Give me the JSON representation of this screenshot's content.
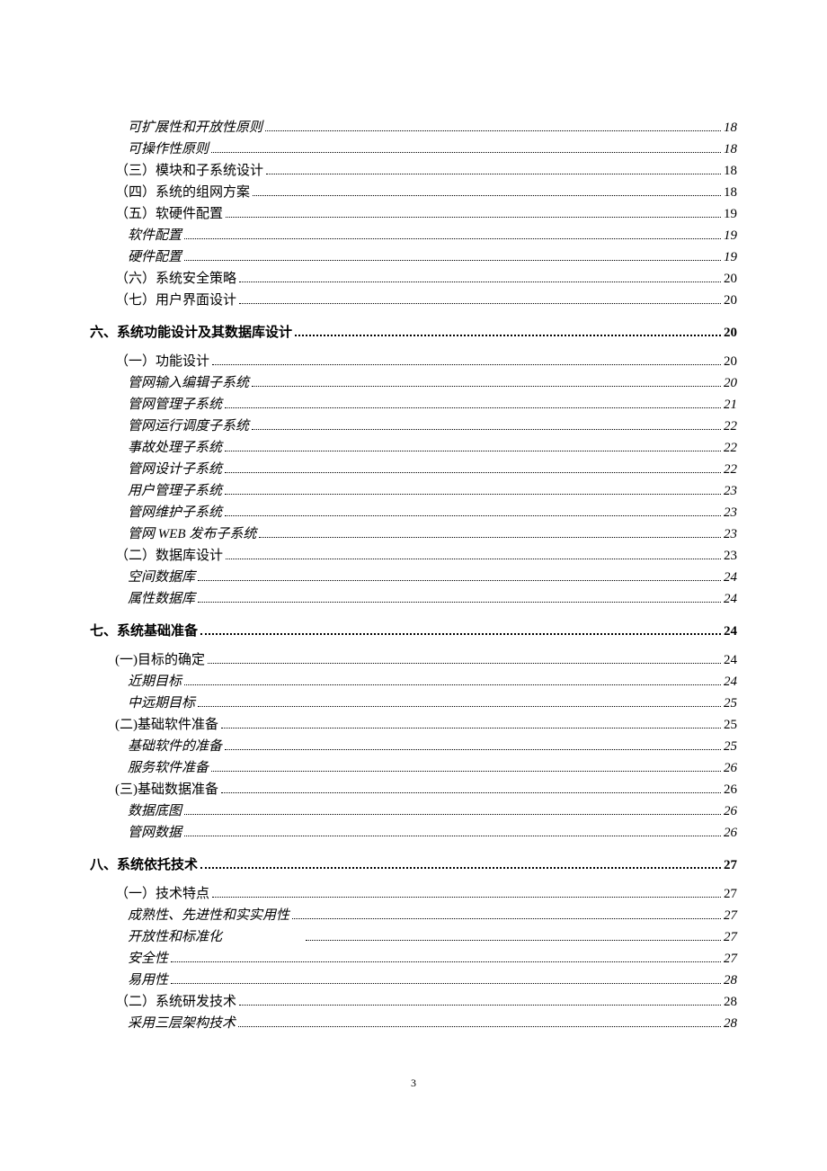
{
  "entries": [
    {
      "label": "可扩展性和开放性原则",
      "page": "18",
      "level": 2,
      "italic": true
    },
    {
      "label": "可操作性原则",
      "page": "18",
      "level": 2,
      "italic": true
    },
    {
      "label": "（三）模块和子系统设计",
      "page": "18",
      "level": 1,
      "italic": false
    },
    {
      "label": "（四）系统的组网方案",
      "page": "18",
      "level": 1,
      "italic": false
    },
    {
      "label": "（五）软硬件配置",
      "page": "19",
      "level": 1,
      "italic": false
    },
    {
      "label": "软件配置",
      "page": "19",
      "level": 2,
      "italic": true
    },
    {
      "label": "硬件配置",
      "page": "19",
      "level": 2,
      "italic": true
    },
    {
      "label": "（六）系统安全策略",
      "page": "20",
      "level": 1,
      "italic": false
    },
    {
      "label": "（七）用户界面设计",
      "page": "20",
      "level": 1,
      "italic": false
    },
    {
      "label": "六、系统功能设计及其数据库设计",
      "page": "20",
      "level": 0,
      "italic": false,
      "heading": true
    },
    {
      "label": "（一）功能设计",
      "page": "20",
      "level": 1,
      "italic": false
    },
    {
      "label": "管网输入编辑子系统",
      "page": "20",
      "level": 2,
      "italic": true
    },
    {
      "label": "管网管理子系统",
      "page": "21",
      "level": 2,
      "italic": true
    },
    {
      "label": "管网运行调度子系统",
      "page": "22",
      "level": 2,
      "italic": true
    },
    {
      "label": "事故处理子系统",
      "page": "22",
      "level": 2,
      "italic": true
    },
    {
      "label": "管网设计子系统",
      "page": "22",
      "level": 2,
      "italic": true
    },
    {
      "label": "用户管理子系统",
      "page": "23",
      "level": 2,
      "italic": true
    },
    {
      "label": "管网维护子系统",
      "page": "23",
      "level": 2,
      "italic": true
    },
    {
      "label": "管网 WEB 发布子系统",
      "page": "23",
      "level": 2,
      "italic": true
    },
    {
      "label": "（二）数据库设计",
      "page": "23",
      "level": 1,
      "italic": false
    },
    {
      "label": "空间数据库",
      "page": "24",
      "level": 2,
      "italic": true
    },
    {
      "label": "属性数据库",
      "page": "24",
      "level": 2,
      "italic": true
    },
    {
      "label": "七、系统基础准备",
      "page": "24",
      "level": 0,
      "italic": false,
      "heading": true
    },
    {
      "label": "(一)目标的确定",
      "page": "24",
      "level": 1,
      "italic": false
    },
    {
      "label": "近期目标",
      "page": "24",
      "level": 2,
      "italic": true
    },
    {
      "label": "中远期目标",
      "page": "25",
      "level": 2,
      "italic": true
    },
    {
      "label": "(二)基础软件准备",
      "page": "25",
      "level": 1,
      "italic": false
    },
    {
      "label": "基础软件的准备",
      "page": "25",
      "level": 2,
      "italic": true
    },
    {
      "label": "服务软件准备",
      "page": "26",
      "level": 2,
      "italic": true
    },
    {
      "label": "(三)基础数据准备",
      "page": "26",
      "level": 1,
      "italic": false
    },
    {
      "label": "数据底图",
      "page": "26",
      "level": 2,
      "italic": true
    },
    {
      "label": "管网数据",
      "page": "26",
      "level": 2,
      "italic": true
    },
    {
      "label": "八、系统依托技术",
      "page": "27",
      "level": 0,
      "italic": false,
      "heading": true
    },
    {
      "label": "（一）技术特点",
      "page": "27",
      "level": 1,
      "italic": false
    },
    {
      "label": "成熟性、先进性和实实用性",
      "page": "27",
      "level": 2,
      "italic": true
    },
    {
      "label": "开放性和标准化",
      "page": "27",
      "level": 2,
      "italic": true,
      "gap": true
    },
    {
      "label": "安全性",
      "page": "27",
      "level": 2,
      "italic": true
    },
    {
      "label": "易用性",
      "page": "28",
      "level": 2,
      "italic": true
    },
    {
      "label": "（二）系统研发技术",
      "page": "28",
      "level": 1,
      "italic": false
    },
    {
      "label": "采用三层架构技术",
      "page": "28",
      "level": 2,
      "italic": true
    }
  ],
  "footer_page": "3"
}
